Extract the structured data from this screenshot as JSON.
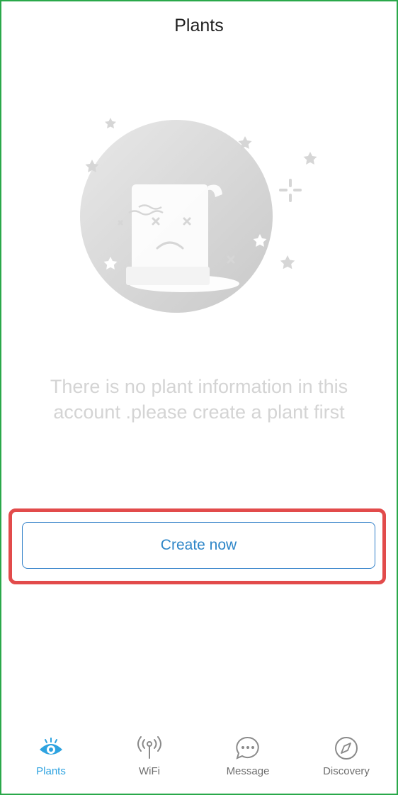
{
  "header": {
    "title": "Plants"
  },
  "empty_state": {
    "message_line1": "There is no plant information in this",
    "message_line2": "account .please create a plant first"
  },
  "actions": {
    "create_label": "Create now"
  },
  "tabbar": {
    "active": "Plants",
    "tabs": [
      {
        "label": "Plants",
        "icon": "eye-icon"
      },
      {
        "label": "WiFi",
        "icon": "antenna-icon"
      },
      {
        "label": "Message",
        "icon": "chat-bubble-icon"
      },
      {
        "label": "Discovery",
        "icon": "compass-icon"
      }
    ]
  },
  "colors": {
    "accent": "#2ea3e0",
    "button_border": "#2f7fc8",
    "highlight_border": "#e24b4b",
    "frame_border": "#2aa84a",
    "muted_text": "#d4d4d4"
  }
}
